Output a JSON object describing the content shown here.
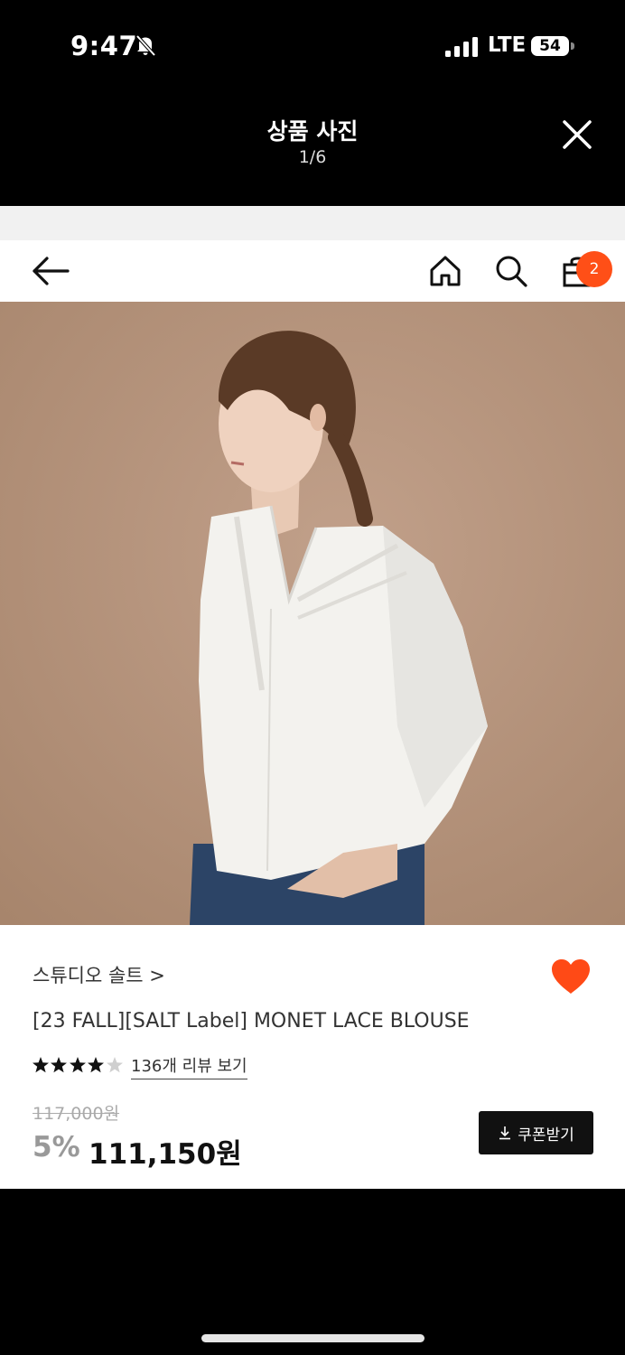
{
  "status_bar": {
    "time": "9:47",
    "network": "LTE",
    "battery": "54"
  },
  "viewer": {
    "title": "상품 사진",
    "counter": "1/6"
  },
  "nav": {
    "cart_count": "2"
  },
  "product": {
    "brand": "스튜디오 솔트 >",
    "name": "[23 FALL][SALT Label] MONET LACE BLOUSE",
    "rating": 4.5,
    "review_link": "136개 리뷰 보기",
    "original_price": "117,000원",
    "discount": "5%",
    "price": "111,150원",
    "coupon_label": "쿠폰받기",
    "wishlisted": true
  },
  "colors": {
    "accent": "#ff4f17",
    "heart": "#ff4a16",
    "photo_bg": "#b5937a"
  },
  "icons": [
    "bell-slash-icon",
    "signal-icon",
    "close-icon",
    "arrow-left-icon",
    "home-icon",
    "search-icon",
    "shopping-bag-icon",
    "heart-icon",
    "star-icon",
    "download-icon"
  ]
}
